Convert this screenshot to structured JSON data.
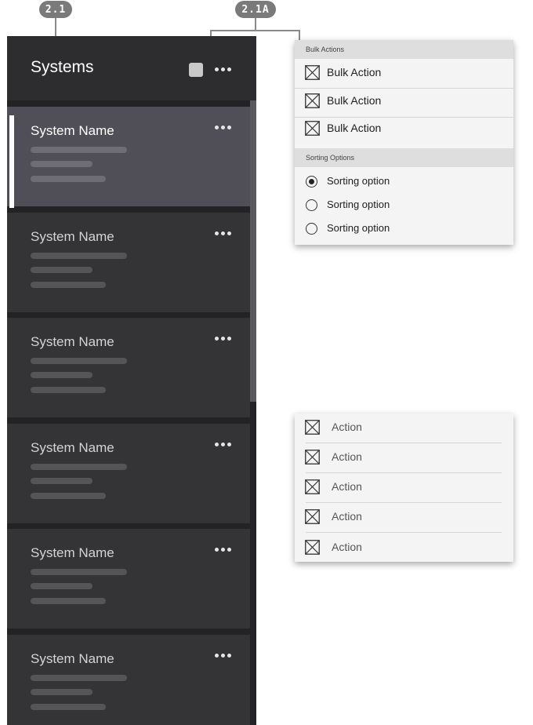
{
  "annotations": {
    "panel_tag": "2.1",
    "menu_tag": "2.1A"
  },
  "panel": {
    "title": "Systems",
    "cards": [
      {
        "name": "System Name",
        "selected": true
      },
      {
        "name": "System Name",
        "selected": false
      },
      {
        "name": "System Name",
        "selected": false
      },
      {
        "name": "System Name",
        "selected": false
      },
      {
        "name": "System Name",
        "selected": false
      },
      {
        "name": "System Name",
        "selected": false
      }
    ]
  },
  "bulk_menu": {
    "bulk_section": "Bulk Actions",
    "bulk_items": [
      "Bulk Action",
      "Bulk Action",
      "Bulk Action"
    ],
    "sorting_section": "Sorting Options",
    "sorting_items": [
      {
        "label": "Sorting option",
        "selected": true
      },
      {
        "label": "Sorting option",
        "selected": false
      },
      {
        "label": "Sorting option",
        "selected": false
      }
    ]
  },
  "card_menu": {
    "items": [
      "Action",
      "Action",
      "Action",
      "Action",
      "Action"
    ]
  },
  "colors": {
    "panel_bg": "#232325",
    "card_bg": "#343436",
    "card_selected_bg": "#504e56",
    "menu_bg": "#f4f4f4"
  },
  "icons": {
    "item_icon": "placeholder-x-icon",
    "overflow_icon": "overflow-menu-icon",
    "checkbox_icon": "select-all-checkbox"
  }
}
